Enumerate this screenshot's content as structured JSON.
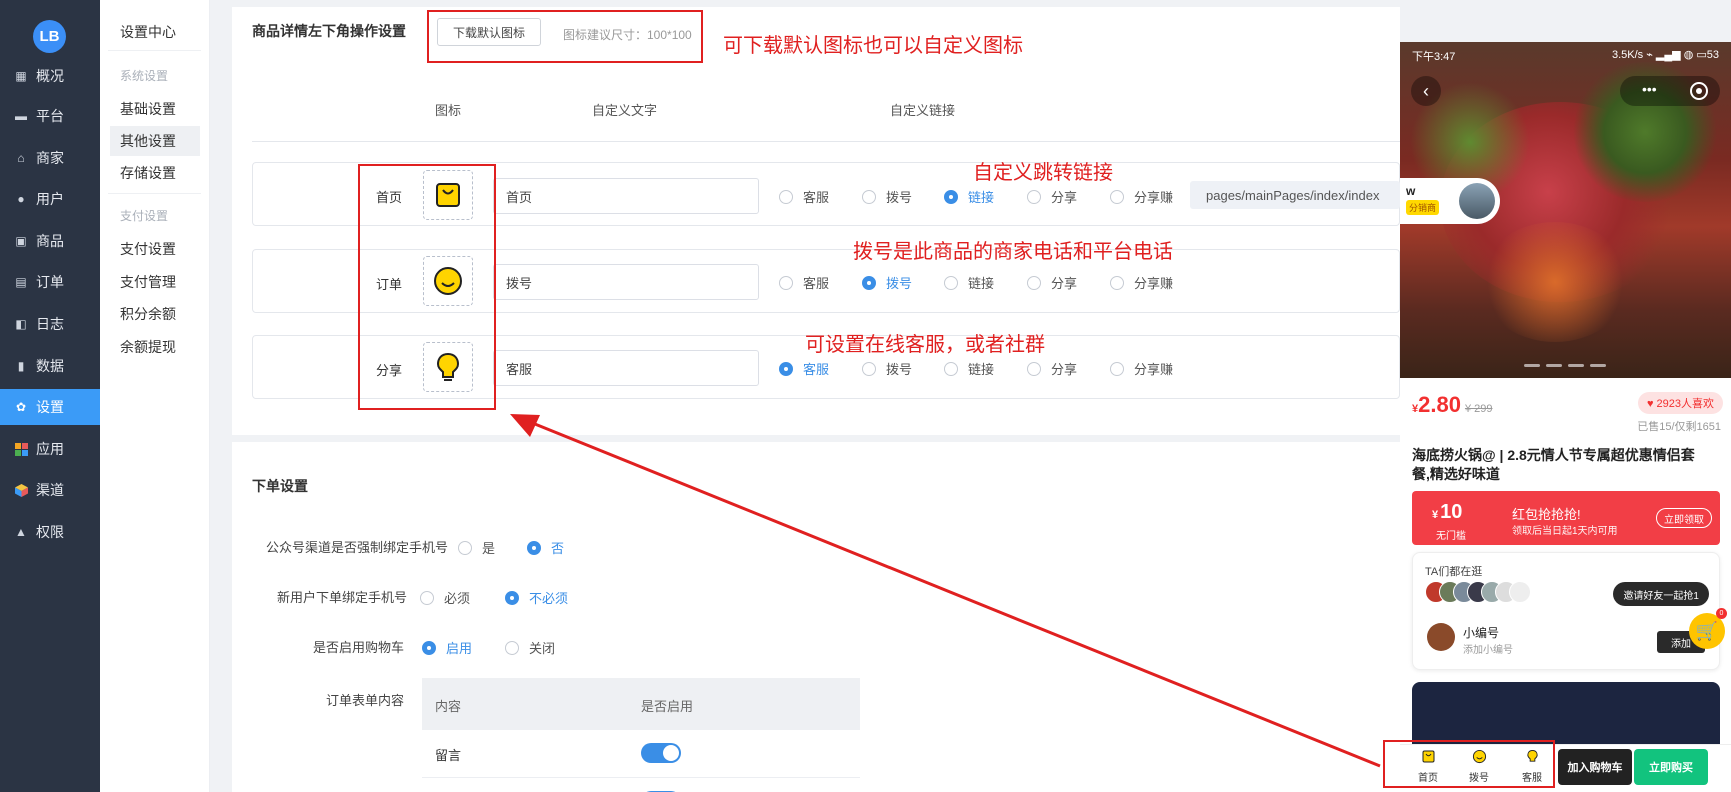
{
  "nav": {
    "logo": "LB",
    "items": [
      {
        "label": "概况",
        "icon": "chart-icon"
      },
      {
        "label": "平台",
        "icon": "monitor-icon"
      },
      {
        "label": "商家",
        "icon": "store-icon"
      },
      {
        "label": "用户",
        "icon": "user-icon"
      },
      {
        "label": "商品",
        "icon": "goods-icon"
      },
      {
        "label": "订单",
        "icon": "order-icon"
      },
      {
        "label": "日志",
        "icon": "log-icon"
      },
      {
        "label": "数据",
        "icon": "bar-chart-icon"
      },
      {
        "label": "设置",
        "icon": "gear-icon"
      },
      {
        "label": "应用",
        "icon": "apps-icon"
      },
      {
        "label": "渠道",
        "icon": "cube-icon"
      },
      {
        "label": "权限",
        "icon": "lock-icon"
      }
    ],
    "active": "设置"
  },
  "subnav": {
    "title": "设置中心",
    "group1": "系统设置",
    "items1": [
      "基础设置",
      "其他设置",
      "存储设置"
    ],
    "active": "其他设置",
    "group2": "支付设置",
    "items2": [
      "支付设置",
      "支付管理",
      "积分余额",
      "余额提现"
    ]
  },
  "section1": {
    "title": "商品详情左下角操作设置",
    "download_btn": "下载默认图标",
    "size_hint": "图标建议尺寸：100*100",
    "columns": [
      "图标",
      "自定义文字",
      "自定义链接"
    ],
    "radio_options": [
      "客服",
      "拨号",
      "链接",
      "分享",
      "分享赚"
    ],
    "rows": [
      {
        "label": "首页",
        "text": "首页",
        "selected": "链接",
        "link": "pages/mainPages/index/index"
      },
      {
        "label": "订单",
        "text": "拨号",
        "selected": "拨号"
      },
      {
        "label": "分享",
        "text": "客服",
        "selected": "客服"
      }
    ]
  },
  "section2": {
    "title": "下单设置",
    "fields": [
      {
        "label": "公众号渠道是否强制绑定手机号",
        "options": [
          "是",
          "否"
        ],
        "selected": "否"
      },
      {
        "label": "新用户下单绑定手机号",
        "options": [
          "必须",
          "不必须"
        ],
        "selected": "不必须"
      },
      {
        "label": "是否启用购物车",
        "options": [
          "启用",
          "关闭"
        ],
        "selected": "启用"
      }
    ],
    "order_form_label": "订单表单内容",
    "table_headers": [
      "内容",
      "是否启用"
    ],
    "table_rows": [
      {
        "name": "留言",
        "enabled": true
      },
      {
        "name": "",
        "enabled": true
      }
    ]
  },
  "annotations": {
    "a1": "可下载默认图标也可以自定义图标",
    "a2": "自定义跳转链接",
    "a3": "拨号是此商品的商家电话和平台电话",
    "a4": "可设置在线客服，或者社群",
    "color": "#e02020"
  },
  "phone": {
    "time": "下午3:47",
    "net": "3.5K/s",
    "battery": "53",
    "back": "‹",
    "more": "•••",
    "user_name": "w",
    "user_tag": "分销商",
    "price_cur": "¥",
    "price": "2.80",
    "old_price": "¥ 299",
    "likes": "♥ 2923人喜欢",
    "sold": "已售15/仅剩1651",
    "title": "海底捞火锅@ | 2.8元情人节专属超优惠情侣套餐,精选好味道",
    "coupon": {
      "cur": "¥",
      "amount": "10",
      "cond": "无门槛",
      "title": "红包抢抢抢!",
      "desc": "领取后当日起1天内可用",
      "btn": "立即领取"
    },
    "ta_title": "TA们都在逛",
    "invite": "邀请好友一起抢1",
    "xb_name": "小编号",
    "xb_sub": "添加小编号",
    "xb_btn": "添加",
    "cart_badge": "0",
    "bottom": {
      "home": "首页",
      "dial": "拨号",
      "service": "客服",
      "add_cart": "加入购物车",
      "buy_now": "立即购买"
    }
  }
}
